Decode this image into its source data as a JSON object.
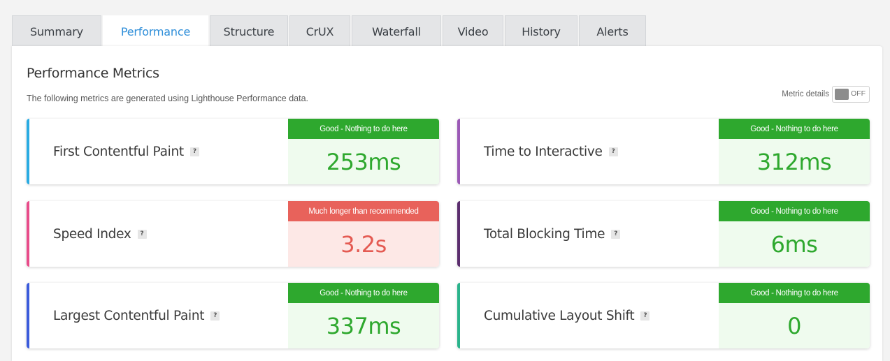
{
  "tabs": [
    "Summary",
    "Performance",
    "Structure",
    "CrUX",
    "Waterfall",
    "Video",
    "History",
    "Alerts"
  ],
  "active_tab": "Performance",
  "panel": {
    "title": "Performance Metrics",
    "subtitle": "The following metrics are generated using Lighthouse Performance data.",
    "metric_details_label": "Metric details",
    "toggle_state": "OFF"
  },
  "metrics": [
    {
      "name": "First Contentful Paint",
      "status": "Good - Nothing to do here",
      "value": "253ms",
      "accent": "#29abe2",
      "rating": "good"
    },
    {
      "name": "Time to Interactive",
      "status": "Good - Nothing to do here",
      "value": "312ms",
      "accent": "#9b59b6",
      "rating": "good"
    },
    {
      "name": "Speed Index",
      "status": "Much longer than recommended",
      "value": "3.2s",
      "accent": "#e84c8a",
      "rating": "bad"
    },
    {
      "name": "Total Blocking Time",
      "status": "Good - Nothing to do here",
      "value": "6ms",
      "accent": "#5b2d6e",
      "rating": "good"
    },
    {
      "name": "Largest Contentful Paint",
      "status": "Good - Nothing to do here",
      "value": "337ms",
      "accent": "#3b5bdb",
      "rating": "good"
    },
    {
      "name": "Cumulative Layout Shift",
      "status": "Good - Nothing to do here",
      "value": "0",
      "accent": "#2ab38b",
      "rating": "good"
    }
  ],
  "colors": {
    "good": "#2ea82e",
    "bad": "#e8625b",
    "active_tab_text": "#2e8ed9"
  },
  "help_icon_glyph": "?"
}
